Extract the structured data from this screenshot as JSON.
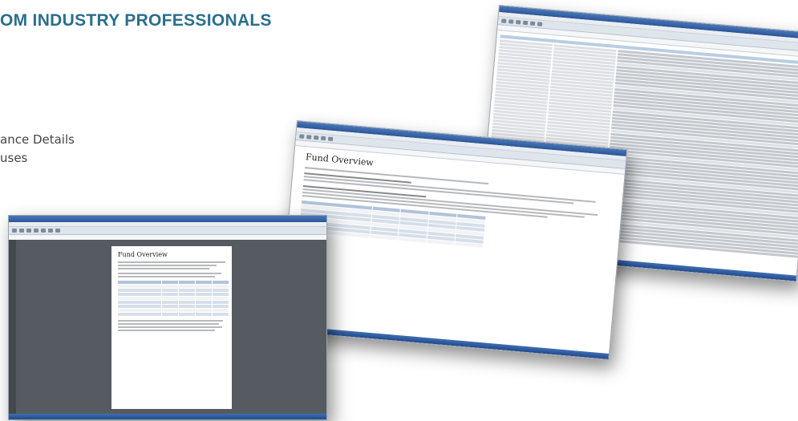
{
  "slide": {
    "heading": "OM INDUSTRY PROFESSIONALS",
    "bullets": [
      "ance Details",
      "uses"
    ]
  },
  "screenshots": {
    "back": {
      "description_label": "spreadsheet-view"
    },
    "middle": {
      "page_title": "Fund Overview"
    },
    "front": {
      "page_title": "Fund Overview"
    }
  },
  "colors": {
    "heading": "#2a6f8c",
    "bullet_text": "#444444",
    "window_chrome": "#2c5597"
  }
}
